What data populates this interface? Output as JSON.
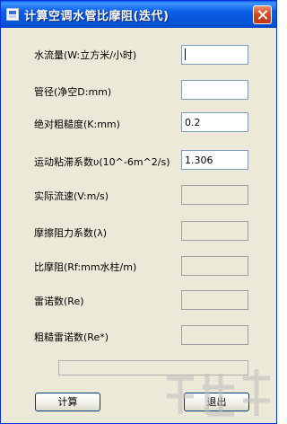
{
  "window": {
    "title": "计算空调水管比摩阻(迭代)"
  },
  "fields": [
    {
      "label": "水流量(W:立方米/小时)",
      "value": "",
      "editable": true
    },
    {
      "label": "管径(净空D:mm)",
      "value": "",
      "editable": true
    },
    {
      "label": "绝对粗糙度(K:mm)",
      "value": "0.2",
      "editable": true
    },
    {
      "label": "运动粘滞系数υ(10^-6m^2/s)",
      "value": "1.306",
      "editable": true
    },
    {
      "label": "实际流速(V:m/s)",
      "value": "",
      "editable": false
    },
    {
      "label": "摩擦阻力系数(λ)",
      "value": "",
      "editable": false
    },
    {
      "label": "比摩阻(Rf:mm水柱/m)",
      "value": "",
      "editable": false
    },
    {
      "label": "雷诺数(Re)",
      "value": "",
      "editable": false
    },
    {
      "label": "粗糙雷诺数(Re*)",
      "value": "",
      "editable": false
    }
  ],
  "progress": {
    "value": 0
  },
  "buttons": {
    "calculate": "计算",
    "exit": "退出"
  },
  "colors": {
    "titlebar": "#0a5ee6",
    "window_bg": "#ece9d8",
    "close": "#d0461f"
  }
}
